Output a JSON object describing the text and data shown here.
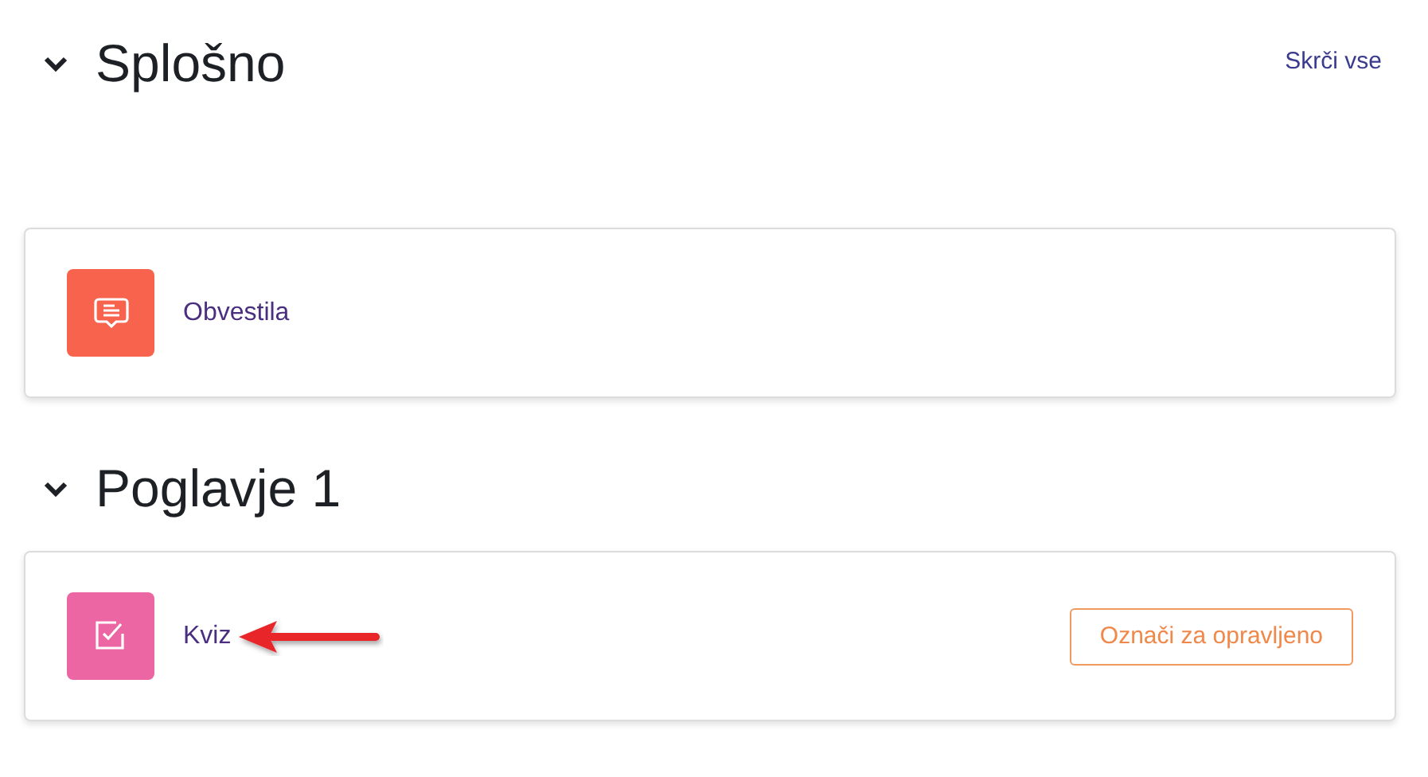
{
  "collapse_link": "Skrči vse",
  "sections": [
    {
      "title": "Splošno",
      "expanded": true,
      "activities": [
        {
          "kind": "forum",
          "name": "Obvestila",
          "color": "#f7634d",
          "pointed": false
        }
      ]
    },
    {
      "title": "Poglavje 1",
      "expanded": true,
      "activities": [
        {
          "kind": "quiz",
          "name": "Kviz",
          "color": "#eb66a2",
          "pointed": true,
          "completion_button": "Označi za opravljeno"
        }
      ]
    }
  ]
}
